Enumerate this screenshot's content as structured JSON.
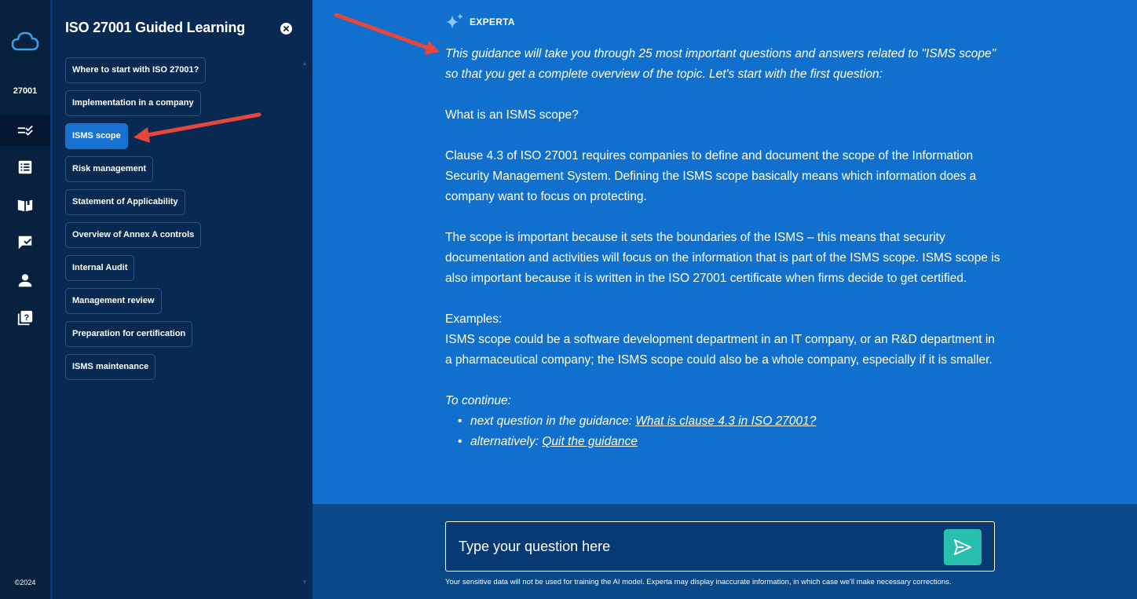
{
  "rail": {
    "code": "27001",
    "copyright": "©2024",
    "items": [
      "guided-learning",
      "list",
      "book",
      "chat",
      "user",
      "help"
    ]
  },
  "panel": {
    "title": "ISO 27001 Guided Learning",
    "topics": [
      "Where to start with ISO 27001?",
      "Implementation in a company",
      "ISMS scope",
      "Risk management",
      "Statement of Applicability",
      "Overview of Annex A controls",
      "Internal Audit",
      "Management review",
      "Preparation for certification",
      "ISMS maintenance"
    ],
    "active_topic": "ISMS scope"
  },
  "main": {
    "assistant_name": "EXPERTA",
    "intro": "This guidance will take you through 25 most important questions and answers related to \"ISMS scope\" so that you get a complete overview of the topic. Let's start with the first question:",
    "question": "What is an ISMS scope?",
    "para1": "Clause 4.3 of ISO 27001 requires companies to define and document the scope of the Information Security Management System. Defining the ISMS scope basically means which information does a company want to focus on protecting.",
    "para2": "The scope is important because it sets the boundaries of the ISMS – this means that security documentation and activities will focus on the information that is part of the ISMS scope. ISMS scope is also important because it is written in the ISO 27001 certificate when firms decide to get certified.",
    "examples_title": "Examples:",
    "examples_text": "ISMS scope could be a software development department in an IT company, or an R&D department in a pharmaceutical company; the ISMS scope could also be a whole company, especially if it is smaller.",
    "continue_title": "To continue:",
    "next_prefix": "next question in the guidance: ",
    "next_link": "What is clause 4.3 in ISO 27001?",
    "alt_prefix": "alternatively: ",
    "alt_link": "Quit the guidance"
  },
  "input": {
    "placeholder": "Type your question here",
    "disclaimer": "Your sensitive data will not be used for training the AI model. Experta may display inaccurate information, in which case we'll make necessary corrections."
  },
  "colors": {
    "accent": "#1772d1",
    "main_bg": "#1170ce",
    "send": "#29bfae",
    "annotation_arrow": "#e8463c"
  }
}
